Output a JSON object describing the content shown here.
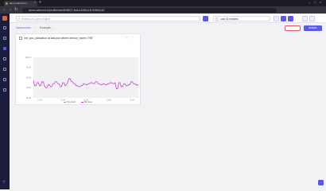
{
  "browser": {
    "tab_title": "demo.selector.io",
    "tab_close": "×",
    "new_tab": "+",
    "url": "demo.selector.io/profile/seed/h6807-3da-b2e9bc18-926b3c16",
    "nav_back": "←",
    "nav_forward": "→",
    "nav_reload": "↻",
    "window_min": "–",
    "window_max": "□",
    "window_close": "×"
  },
  "topbar": {
    "search_placeholder": "Selector AI Query Engine",
    "time_range": "Last 30 minutes"
  },
  "breadcrumb": {
    "root": "Dashboards",
    "current": "Example"
  },
  "actions_label": "Actions",
  "panel": {
    "title": "net_cpu_utilization at last plot where device_name=\"HE\"",
    "chart_data": {
      "type": "line",
      "x_ticks": [
        "13:25",
        "13:30",
        "13:35",
        "13:40",
        "13:45"
      ],
      "y_ticks": [
        "100.00",
        "90.00",
        "80.00",
        "70.00",
        "60.00"
      ],
      "ylim": [
        60,
        100
      ],
      "legend": [
        "Threshold",
        "HE Value"
      ],
      "colors": {
        "threshold": "#9aa0b4",
        "value": "#c545c9"
      },
      "series": [
        {
          "name": "HE Value",
          "values": [
            77,
            72,
            72,
            75,
            75,
            72,
            72,
            76,
            76,
            72,
            70,
            70,
            73,
            73,
            71,
            71,
            74,
            74,
            76,
            76,
            74,
            74,
            71,
            71,
            75,
            75,
            72,
            73,
            75,
            79,
            79,
            76,
            76,
            74,
            74,
            72,
            72,
            71,
            71,
            72,
            72,
            74,
            74,
            73,
            73,
            74,
            74,
            75,
            75,
            74,
            74,
            76,
            76,
            74,
            74,
            73,
            73,
            74,
            74,
            73,
            73,
            74,
            74,
            75,
            75,
            74,
            74,
            75,
            69,
            69,
            75,
            75,
            71,
            71,
            74,
            74,
            72,
            72,
            73,
            73,
            76,
            76,
            74,
            74,
            73,
            73,
            72
          ]
        }
      ]
    }
  }
}
